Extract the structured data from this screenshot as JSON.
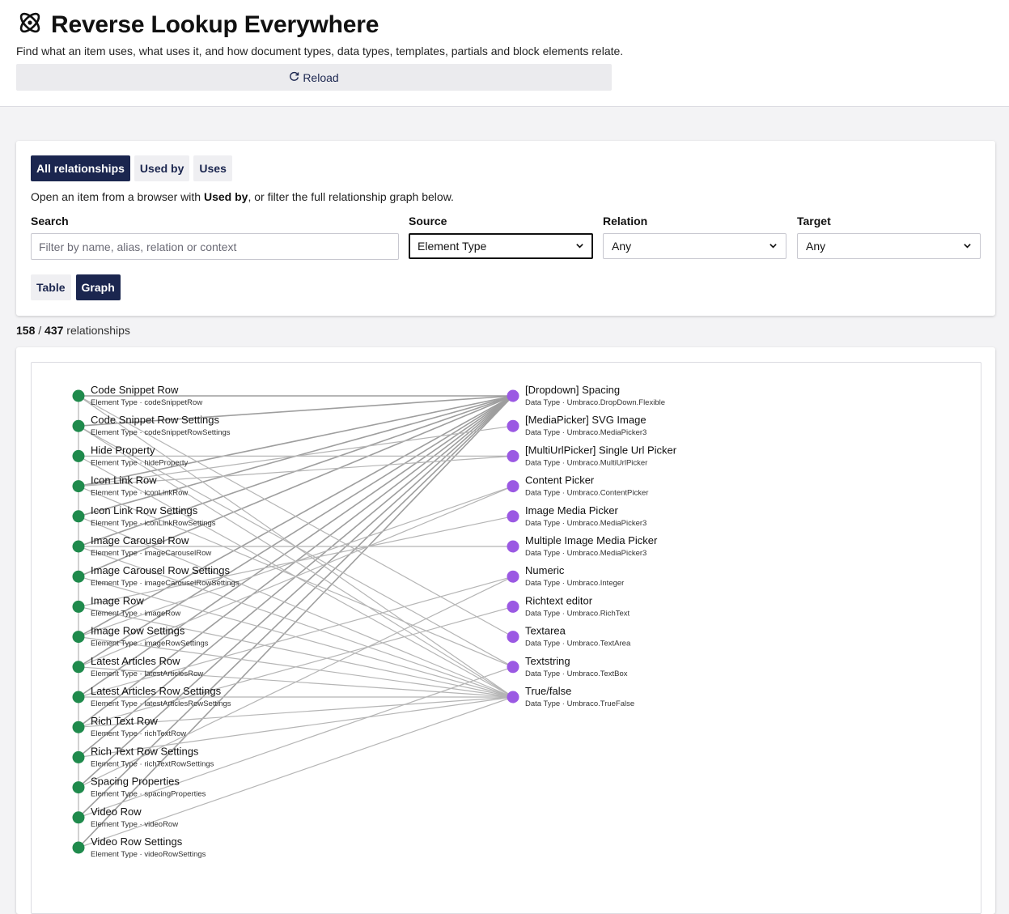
{
  "header": {
    "title": "Reverse Lookup Everywhere",
    "subtitle": "Find what an item uses, what uses it, and how document types, data types, templates, partials and block elements relate.",
    "reload_label": "Reload"
  },
  "tabs": [
    {
      "label": "All relationships",
      "active": true
    },
    {
      "label": "Used by",
      "active": false
    },
    {
      "label": "Uses",
      "active": false
    }
  ],
  "hint": {
    "before": "Open an item from a browser with ",
    "strong": "Used by",
    "after": ", or filter the full relationship graph below."
  },
  "filters": {
    "search_label": "Search",
    "search_placeholder": "Filter by name, alias, relation or context",
    "search_value": "",
    "source_label": "Source",
    "source_value": "Element Type",
    "relation_label": "Relation",
    "relation_value": "Any",
    "target_label": "Target",
    "target_value": "Any"
  },
  "view": {
    "table_label": "Table",
    "graph_label": "Graph",
    "active": "Graph"
  },
  "summary": {
    "shown": "158",
    "separator": "/",
    "total": "437",
    "suffix": "relationships"
  },
  "colors": {
    "source_node": "#1f8a4c",
    "target_node": "#9b59e3",
    "edge": "#b5b5b5",
    "accent": "#1b264f"
  },
  "graph": {
    "sources": [
      {
        "name": "Code Snippet Row",
        "meta": "Element Type · codeSnippetRow"
      },
      {
        "name": "Code Snippet Row Settings",
        "meta": "Element Type · codeSnippetRowSettings"
      },
      {
        "name": "Hide Property",
        "meta": "Element Type · hideProperty"
      },
      {
        "name": "Icon Link Row",
        "meta": "Element Type · iconLinkRow"
      },
      {
        "name": "Icon Link Row Settings",
        "meta": "Element Type · iconLinkRowSettings"
      },
      {
        "name": "Image Carousel Row",
        "meta": "Element Type · imageCarouselRow"
      },
      {
        "name": "Image Carousel Row Settings",
        "meta": "Element Type · imageCarouselRowSettings"
      },
      {
        "name": "Image Row",
        "meta": "Element Type · imageRow"
      },
      {
        "name": "Image Row Settings",
        "meta": "Element Type · imageRowSettings"
      },
      {
        "name": "Latest Articles Row",
        "meta": "Element Type · latestArticlesRow"
      },
      {
        "name": "Latest Articles Row Settings",
        "meta": "Element Type · latestArticlesRowSettings"
      },
      {
        "name": "Rich Text Row",
        "meta": "Element Type · richTextRow"
      },
      {
        "name": "Rich Text Row Settings",
        "meta": "Element Type · richTextRowSettings"
      },
      {
        "name": "Spacing Properties",
        "meta": "Element Type · spacingProperties"
      },
      {
        "name": "Video Row",
        "meta": "Element Type · videoRow"
      },
      {
        "name": "Video Row Settings",
        "meta": "Element Type · videoRowSettings"
      }
    ],
    "targets": [
      {
        "name": "[Dropdown] Spacing",
        "meta": "Data Type · Umbraco.DropDown.Flexible"
      },
      {
        "name": "[MediaPicker] SVG Image",
        "meta": "Data Type · Umbraco.MediaPicker3"
      },
      {
        "name": "[MultiUrlPicker] Single Url Picker",
        "meta": "Data Type · Umbraco.MultiUrlPicker"
      },
      {
        "name": "Content Picker",
        "meta": "Data Type · Umbraco.ContentPicker"
      },
      {
        "name": "Image Media Picker",
        "meta": "Data Type · Umbraco.MediaPicker3"
      },
      {
        "name": "Multiple Image Media Picker",
        "meta": "Data Type · Umbraco.MediaPicker3"
      },
      {
        "name": "Numeric",
        "meta": "Data Type · Umbraco.Integer"
      },
      {
        "name": "Richtext editor",
        "meta": "Data Type · Umbraco.RichText"
      },
      {
        "name": "Textarea",
        "meta": "Data Type · Umbraco.TextArea"
      },
      {
        "name": "Textstring",
        "meta": "Data Type · Umbraco.TextBox"
      },
      {
        "name": "True/false",
        "meta": "Data Type · Umbraco.TrueFalse"
      }
    ],
    "edges": [
      [
        0,
        0
      ],
      [
        1,
        0
      ],
      [
        3,
        0
      ],
      [
        4,
        0
      ],
      [
        5,
        0
      ],
      [
        6,
        0
      ],
      [
        8,
        0
      ],
      [
        9,
        0
      ],
      [
        10,
        0
      ],
      [
        11,
        0
      ],
      [
        12,
        0
      ],
      [
        13,
        0
      ],
      [
        14,
        0
      ],
      [
        15,
        0
      ],
      [
        0,
        8
      ],
      [
        0,
        10
      ],
      [
        1,
        10
      ],
      [
        1,
        9
      ],
      [
        2,
        2
      ],
      [
        2,
        10
      ],
      [
        3,
        1
      ],
      [
        3,
        2
      ],
      [
        3,
        9
      ],
      [
        4,
        10
      ],
      [
        5,
        5
      ],
      [
        5,
        10
      ],
      [
        6,
        10
      ],
      [
        7,
        4
      ],
      [
        7,
        10
      ],
      [
        8,
        10
      ],
      [
        8,
        3
      ],
      [
        9,
        3
      ],
      [
        9,
        10
      ],
      [
        10,
        10
      ],
      [
        10,
        6
      ],
      [
        11,
        7
      ],
      [
        11,
        10
      ],
      [
        12,
        10
      ],
      [
        13,
        6
      ],
      [
        14,
        9
      ],
      [
        15,
        10
      ]
    ]
  }
}
